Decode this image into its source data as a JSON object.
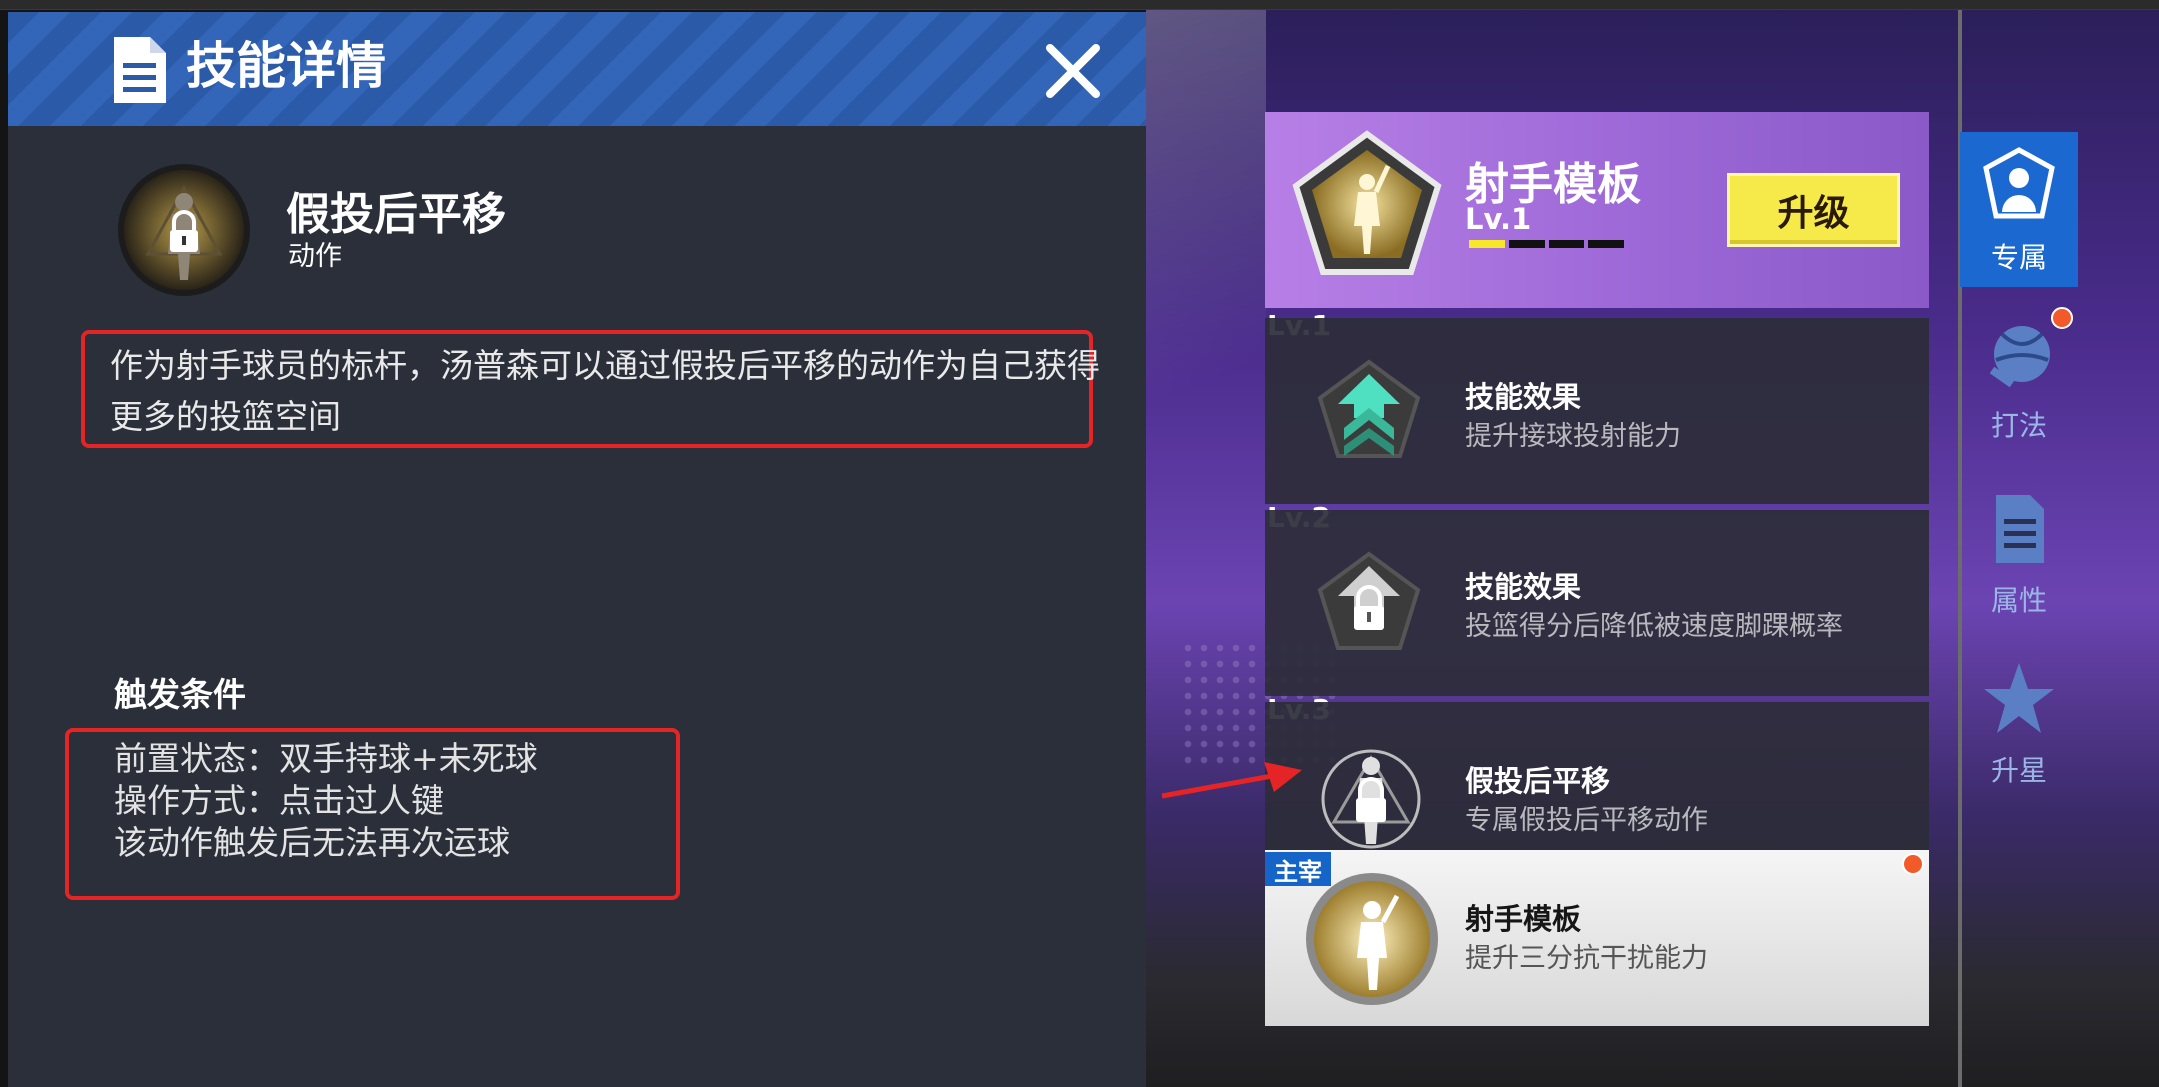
{
  "detail": {
    "title": "技能详情",
    "skill_name": "假投后平移",
    "skill_type": "动作",
    "description": "作为射手球员的标杆，汤普森可以通过假投后平移的动作为自己获得更多的投篮空间",
    "trigger_title": "触发条件",
    "conditions": [
      "前置状态：双手持球+未死球",
      "操作方式：点击过人键",
      "该动作触发后无法再次运球"
    ]
  },
  "template": {
    "title": "射手模板",
    "level": "Lv.1",
    "level_progress": 0.25,
    "upgrade_label": "升级"
  },
  "levels": [
    {
      "label": "Lv.1",
      "title": "技能效果",
      "desc": "提升接球投射能力",
      "locked": false
    },
    {
      "label": "Lv.2",
      "title": "技能效果",
      "desc": "投篮得分后降低被速度脚踝概率",
      "locked": true
    },
    {
      "label": "Lv.3",
      "title": "假投后平移",
      "desc": "专属假投后平移动作",
      "locked": true
    }
  ],
  "main_skill": {
    "tag": "主宰",
    "title": "射手模板",
    "desc": "提升三分抗干扰能力"
  },
  "tabs": [
    {
      "label": "专属",
      "active": true,
      "icon": "exclusive-icon"
    },
    {
      "label": "打法",
      "active": false,
      "icon": "playstyle-icon",
      "notify": true
    },
    {
      "label": "属性",
      "active": false,
      "icon": "attribute-doc-icon"
    },
    {
      "label": "升星",
      "active": false,
      "icon": "star-icon"
    }
  ],
  "colors": {
    "header_blue": "#2b5aa8",
    "panel_bg": "#2a2f3a",
    "highlight_red": "#e52525",
    "upgrade_yellow": "#f6e94a",
    "tab_active": "#1a68d0"
  }
}
